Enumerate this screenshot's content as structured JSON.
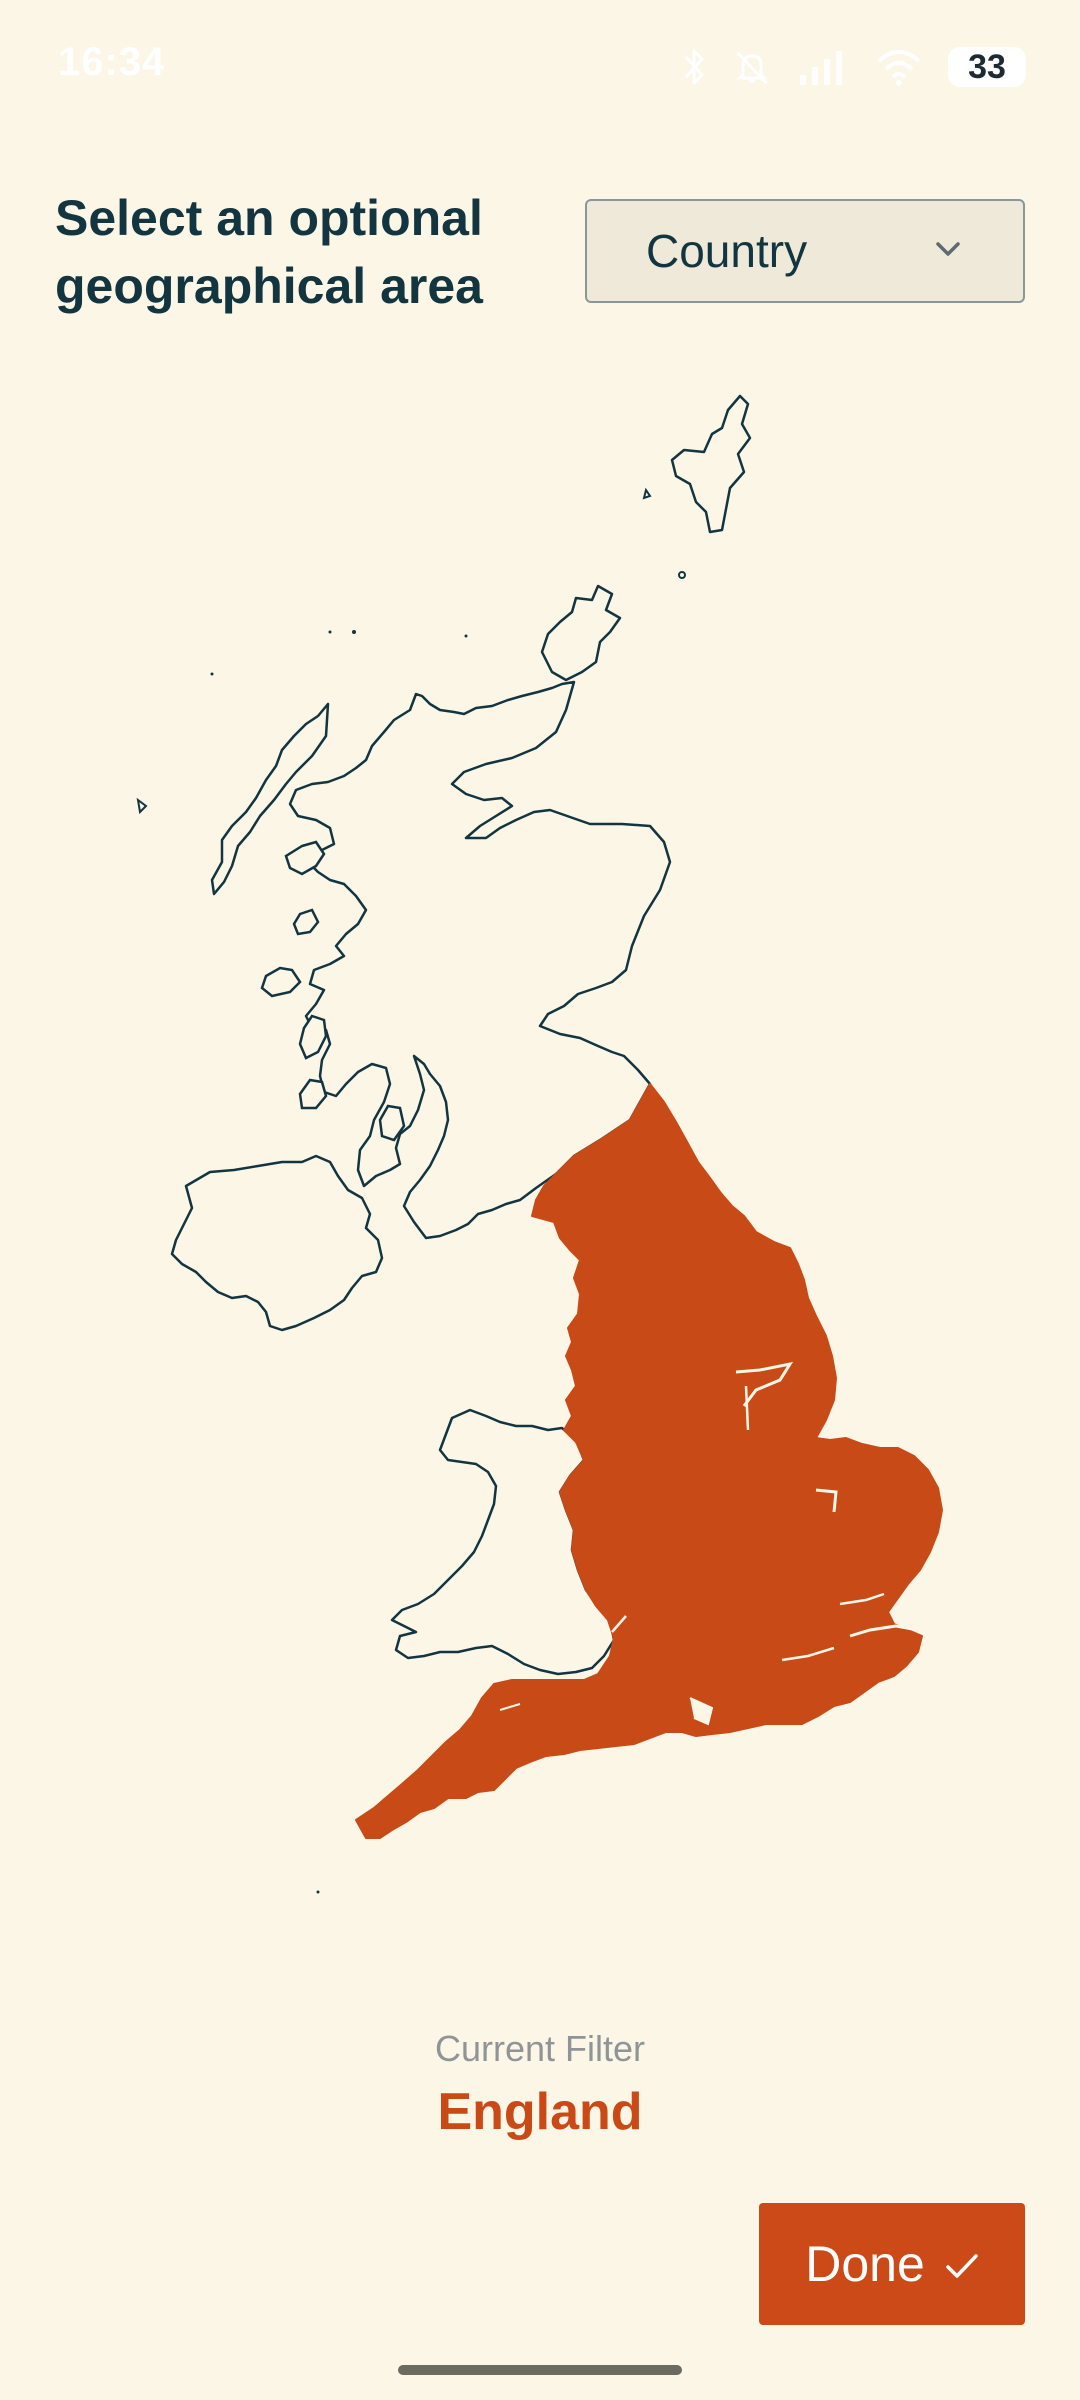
{
  "status_bar": {
    "time": "16:34",
    "battery": "33"
  },
  "header": {
    "title": "Select an optional geographical area"
  },
  "area_select": {
    "selected": "Country"
  },
  "map": {
    "selected_region": "England",
    "highlight_color": "#c84a17",
    "outline_color": "#123540"
  },
  "filter": {
    "caption": "Current Filter",
    "value": "England"
  },
  "done_button": {
    "label": "Done"
  },
  "icons": {
    "bluetooth": "bluetooth-icon",
    "mute": "bell-muted-icon",
    "signal": "signal-icon",
    "wifi": "wifi-icon",
    "dropdown": "chevron-down-icon",
    "check": "check-icon"
  }
}
